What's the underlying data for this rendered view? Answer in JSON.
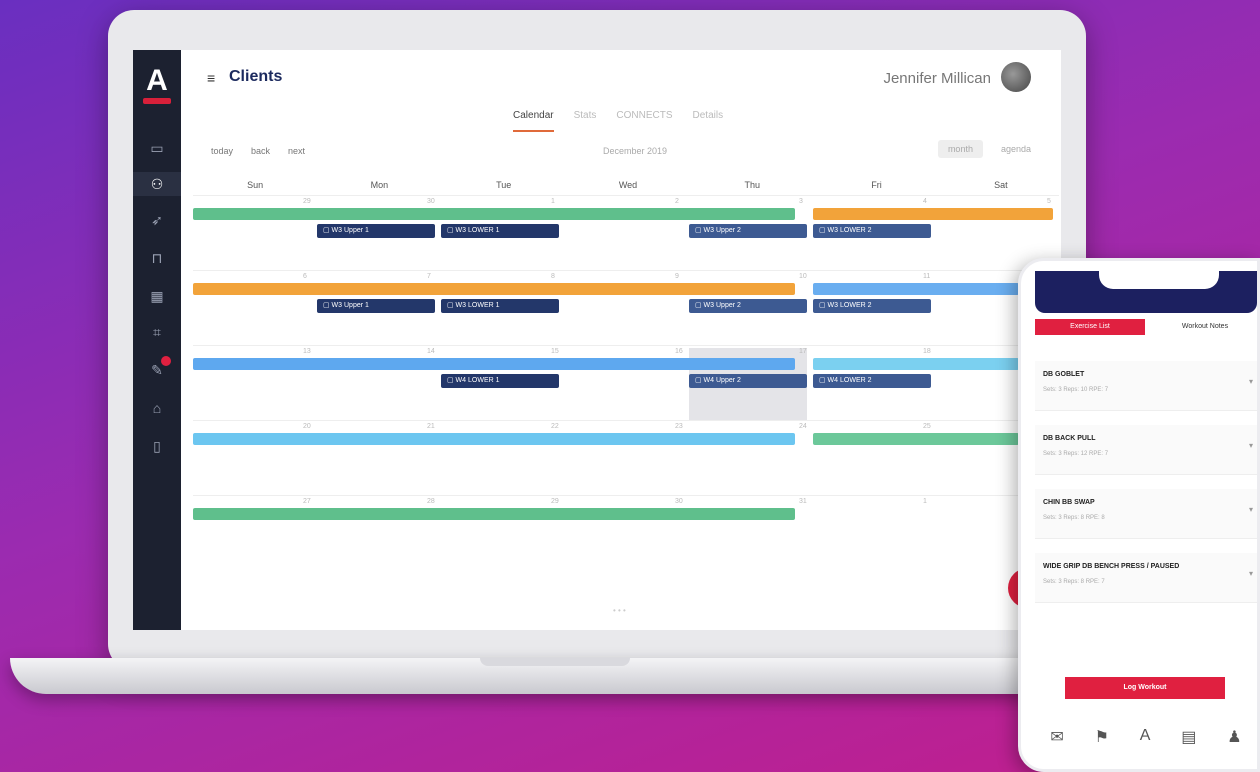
{
  "app": {
    "title": "Clients",
    "user_name": "Jennifer Millican"
  },
  "tabs": [
    "Calendar",
    "Stats",
    "CONNECTS",
    "Details"
  ],
  "toolbar": {
    "today": "today",
    "back": "back",
    "next": "next",
    "month": "December 2019",
    "month_view": "month",
    "agenda_view": "agenda"
  },
  "days": [
    "Sun",
    "Mon",
    "Tue",
    "Wed",
    "Thu",
    "Fri",
    "Sat"
  ],
  "weeks": [
    {
      "dates": [
        "29",
        "30",
        "1",
        "2",
        "3",
        "4",
        "5"
      ],
      "events": [
        {
          "label": "W3 Upper 1",
          "col": 1
        },
        {
          "label": "W3 LOWER 1",
          "col": 2
        },
        {
          "label": "W3 Upper 2",
          "col": 4
        },
        {
          "label": "W3 LOWER 2",
          "col": 5
        }
      ]
    },
    {
      "dates": [
        "6",
        "7",
        "8",
        "9",
        "10",
        "11",
        "12"
      ],
      "events": [
        {
          "label": "W3 Upper 1",
          "col": 1
        },
        {
          "label": "W3 LOWER 1",
          "col": 2
        },
        {
          "label": "W3 Upper 2",
          "col": 4
        },
        {
          "label": "W3 LOWER 2",
          "col": 5
        }
      ]
    },
    {
      "dates": [
        "13",
        "14",
        "15",
        "16",
        "17",
        "18",
        "19"
      ],
      "events": [
        {
          "label": "W4 LOWER 1",
          "col": 2
        },
        {
          "label": "W4 Upper 2",
          "col": 4
        },
        {
          "label": "W4 LOWER 2",
          "col": 5
        }
      ]
    },
    {
      "dates": [
        "20",
        "21",
        "22",
        "23",
        "24",
        "25",
        "26"
      ],
      "events": []
    },
    {
      "dates": [
        "27",
        "28",
        "29",
        "30",
        "31",
        "1",
        "2"
      ],
      "events": []
    }
  ],
  "phone": {
    "tab_active": "Exercise List",
    "tab_other": "Workout Notes",
    "cards": [
      {
        "title": "DB GOBLET",
        "meta": "Sets: 3     Reps: 10     RPE: 7"
      },
      {
        "title": "DB BACK PULL",
        "meta": "Sets: 3     Reps: 12     RPE: 7"
      },
      {
        "title": "CHIN BB SWAP",
        "meta": "Sets: 3     Reps: 8     RPE: 8"
      },
      {
        "title": "WIDE GRIP DB BENCH PRESS / PAUSED",
        "meta": "Sets: 3     Reps: 8     RPE: 7"
      }
    ],
    "log_button": "Log Workout"
  }
}
